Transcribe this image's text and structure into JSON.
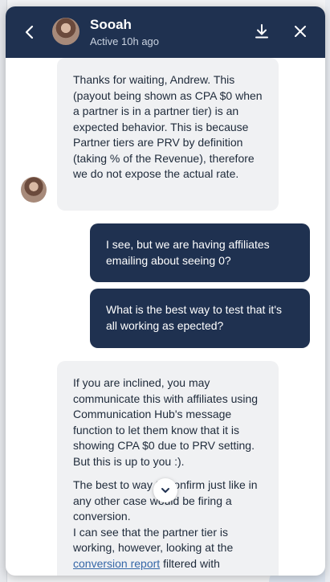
{
  "header": {
    "name": "Sooah",
    "status": "Active 10h ago"
  },
  "messages": {
    "m1": "Thanks for waiting, Andrew. This (payout being shown as CPA $0 when a partner is in a partner tier) is an expected behavior. This is because Partner tiers are PRV by definition (taking % of the Revenue), therefore we do not expose the actual rate.",
    "m2": "I see, but we are having affiliates emailing about seeing 0?",
    "m3": "What is the best way to test that it's all working as epected?",
    "m4_p1": "If you are inclined, you may communicate this with affiliates using Communication Hub's message function to let them know that it is showing CPA $0 due to PRV setting. But this is up to you :).",
    "m4_p2": "The best to way to confirm just like in any other case would be firing a conversion.",
    "m4_p3_before": "I can see that the partner tier is working, however, looking at the",
    "m4_link": "conversion report",
    "m4_p3_after": "filtered with"
  },
  "colors": {
    "header_bg": "#1f3150",
    "outgoing_bg": "#1f3150",
    "incoming_bg": "#f0f1f3",
    "link": "#3567a8"
  },
  "icons": {
    "back": "chevron-left-icon",
    "download": "download-icon",
    "close": "close-icon",
    "scroll": "chevron-down-icon"
  }
}
